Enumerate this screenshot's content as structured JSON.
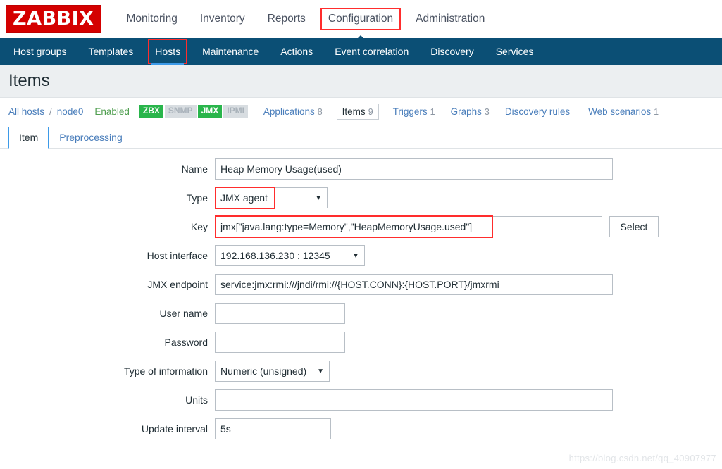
{
  "brand": {
    "logo_text": "ZABBIX"
  },
  "topnav": {
    "items": [
      {
        "label": "Monitoring"
      },
      {
        "label": "Inventory"
      },
      {
        "label": "Reports"
      },
      {
        "label": "Configuration"
      },
      {
        "label": "Administration"
      }
    ]
  },
  "subnav": {
    "items": [
      {
        "label": "Host groups"
      },
      {
        "label": "Templates"
      },
      {
        "label": "Hosts"
      },
      {
        "label": "Maintenance"
      },
      {
        "label": "Actions"
      },
      {
        "label": "Event correlation"
      },
      {
        "label": "Discovery"
      },
      {
        "label": "Services"
      }
    ]
  },
  "page": {
    "title": "Items"
  },
  "breadcrumb": {
    "all_hosts": "All hosts",
    "separator": "/",
    "host": "node0",
    "status": "Enabled",
    "badges": [
      {
        "label": "ZBX",
        "state": "on"
      },
      {
        "label": "SNMP",
        "state": "off"
      },
      {
        "label": "JMX",
        "state": "on"
      },
      {
        "label": "IPMI",
        "state": "off"
      }
    ],
    "tabs": [
      {
        "label": "Applications",
        "count": "8"
      },
      {
        "label": "Items",
        "count": "9"
      },
      {
        "label": "Triggers",
        "count": "1"
      },
      {
        "label": "Graphs",
        "count": "3"
      },
      {
        "label": "Discovery rules",
        "count": ""
      },
      {
        "label": "Web scenarios",
        "count": "1"
      }
    ]
  },
  "form_tabs": {
    "items": [
      {
        "label": "Item"
      },
      {
        "label": "Preprocessing"
      }
    ]
  },
  "form": {
    "name": {
      "label": "Name",
      "value": "Heap Memory Usage(used)"
    },
    "type": {
      "label": "Type",
      "value": "JMX agent"
    },
    "key": {
      "label": "Key",
      "value": "jmx[\"java.lang:type=Memory\",\"HeapMemoryUsage.used\"]",
      "select_button": "Select"
    },
    "host_interface": {
      "label": "Host interface",
      "value": "192.168.136.230 : 12345"
    },
    "jmx_endpoint": {
      "label": "JMX endpoint",
      "value": "service:jmx:rmi:///jndi/rmi://{HOST.CONN}:{HOST.PORT}/jmxrmi"
    },
    "user_name": {
      "label": "User name",
      "value": ""
    },
    "password": {
      "label": "Password",
      "value": ""
    },
    "type_of_information": {
      "label": "Type of information",
      "value": "Numeric (unsigned)"
    },
    "units": {
      "label": "Units",
      "value": ""
    },
    "update_interval": {
      "label": "Update interval",
      "value": "5s"
    }
  },
  "icons": {
    "caret_down": "▼"
  },
  "watermark": {
    "text": "https://blog.csdn.net/qq_40907977"
  },
  "colors": {
    "brand_red": "#d40000",
    "nav_blue": "#0b4f75",
    "accent_blue": "#3d9ae8",
    "link_blue": "#4a7ebb",
    "status_green": "#4f9e4f",
    "badge_on": "#29b54b",
    "badge_off": "#d8dde1",
    "annotation_red": "#ff2d2d"
  }
}
